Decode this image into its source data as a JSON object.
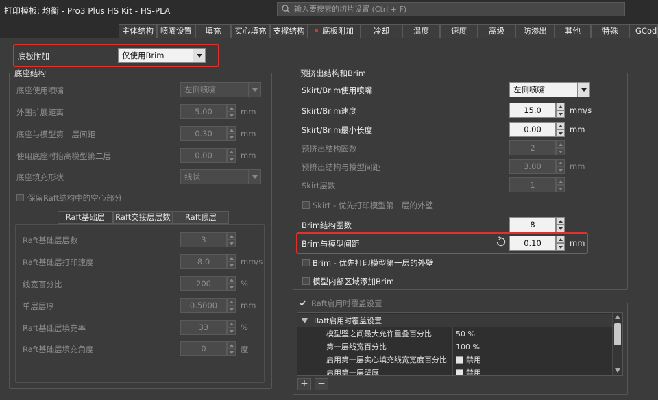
{
  "window": {
    "title": "打印模板: 均衡 - Pro3 Plus HS Kit - HS-PLA"
  },
  "search": {
    "placeholder": "输入要搜索的切片设置 (Ctrl + F)"
  },
  "tabs": [
    {
      "label": "主体结构"
    },
    {
      "label": "喷嘴设置"
    },
    {
      "label": "填充"
    },
    {
      "label": "实心填充"
    },
    {
      "label": "支撑结构"
    },
    {
      "label": "底板附加",
      "active": true
    },
    {
      "label": "冷却"
    },
    {
      "label": "温度"
    },
    {
      "label": "速度"
    },
    {
      "label": "高级"
    },
    {
      "label": "防渗出"
    },
    {
      "label": "其他"
    },
    {
      "label": "特殊"
    },
    {
      "label": "GCode"
    }
  ],
  "accent_color": "#e0312a",
  "platform": {
    "label": "底板附加",
    "value": "仅使用Brim"
  },
  "raft": {
    "title": "底座结构",
    "nozzle": {
      "label": "底座使用喷嘴",
      "value": "左侧喷嘴"
    },
    "offset": {
      "label": "外围扩展距离",
      "value": "5.00",
      "unit": "mm"
    },
    "separation": {
      "label": "底座与模型第一层间距",
      "value": "0.30",
      "unit": "mm"
    },
    "lift": {
      "label": "使用底座时抬高模型第二层",
      "value": "0.00",
      "unit": "mm"
    },
    "infill": {
      "label": "底座填充形状",
      "value": "线状"
    },
    "keep_hollow": {
      "label": "保留Raft结构中的空心部分"
    },
    "subtabs": [
      "Raft基础层",
      "Raft交接层层数",
      "Raft顶层"
    ],
    "base_layers": {
      "label": "Raft基础层层数",
      "value": "3"
    },
    "base_speed": {
      "label": "Raft基础层打印速度",
      "value": "8.0",
      "unit": "mm/s"
    },
    "width_pct": {
      "label": "线宽百分比",
      "value": "200",
      "unit": "%"
    },
    "layer_thickness": {
      "label": "单层层厚",
      "value": "0.5000",
      "unit": "mm"
    },
    "fill_rate": {
      "label": "Raft基础层填充率",
      "value": "33",
      "unit": "%"
    },
    "fill_angle": {
      "label": "Raft基础层填充角度",
      "value": "0",
      "unit": "度"
    }
  },
  "skirt": {
    "title": "预挤出结构和Brim",
    "nozzle": {
      "label": "Skirt/Brim使用喷嘴",
      "value": "左侧喷嘴"
    },
    "speed": {
      "label": "Skirt/Brim速度",
      "value": "15.0",
      "unit": "mm/s"
    },
    "min_length": {
      "label": "Skirt/Brim最小长度",
      "value": "0.00",
      "unit": "mm"
    },
    "outlines": {
      "label": "预挤出结构圈数",
      "value": "2"
    },
    "distance": {
      "label": "预挤出结构与模型间距",
      "value": "3.00",
      "unit": "mm"
    },
    "layers": {
      "label": "Skirt层数",
      "value": "1"
    },
    "skirt_first": {
      "label": "Skirt - 优先打印模型第一层的外壁"
    },
    "brim_outlines": {
      "label": "Brim结构圈数",
      "value": "8"
    },
    "brim_gap": {
      "label": "Brim与模型间距",
      "value": "0.10",
      "unit": "mm"
    },
    "brim_first": {
      "label": "Brim - 优先打印模型第一层的外壁"
    },
    "brim_inner": {
      "label": "模型内部区域添加Brim"
    }
  },
  "override": {
    "title": "Raft启用时覆盖设置",
    "tree_header": "Raft启用时覆盖设置",
    "rows": [
      {
        "name": "模型壁之间最大允许重叠百分比",
        "value": "50 %"
      },
      {
        "name": "第一层线宽百分比",
        "value": "100 %"
      },
      {
        "name": "启用第一层实心填充线宽宽度百分比",
        "value": "禁用"
      },
      {
        "name": "启用第一层壁厚",
        "value": "禁用"
      }
    ],
    "add_label": "+",
    "remove_label": "−"
  }
}
